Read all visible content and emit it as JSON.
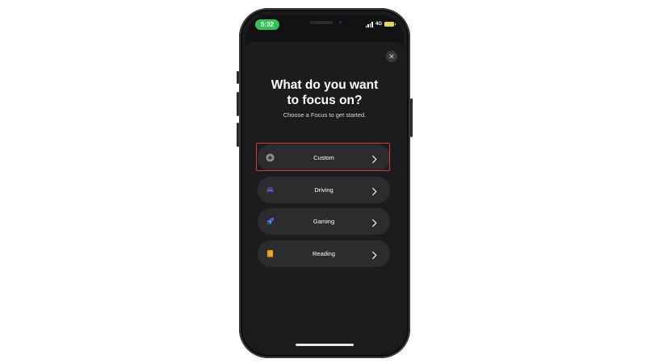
{
  "status_bar": {
    "time": "5:32",
    "network": "4G"
  },
  "sheet": {
    "close_symbol": "✕",
    "headline_line1": "What do you want",
    "headline_line2": "to focus on?",
    "subtitle": "Choose a Focus to get started."
  },
  "options": [
    {
      "label": "Custom",
      "icon": "plus-circle-icon",
      "icon_color": "#8e8e93",
      "highlighted": true
    },
    {
      "label": "Driving",
      "icon": "car-icon",
      "icon_color": "#5e5ce6",
      "highlighted": false
    },
    {
      "label": "Gaming",
      "icon": "rocket-icon",
      "icon_color": "#3a82f7",
      "highlighted": false
    },
    {
      "label": "Reading",
      "icon": "book-icon",
      "icon_color": "#f5a623",
      "highlighted": false
    }
  ],
  "colors": {
    "highlight": "#e0323a",
    "time_pill": "#32c458",
    "battery": "#e8d94a"
  }
}
